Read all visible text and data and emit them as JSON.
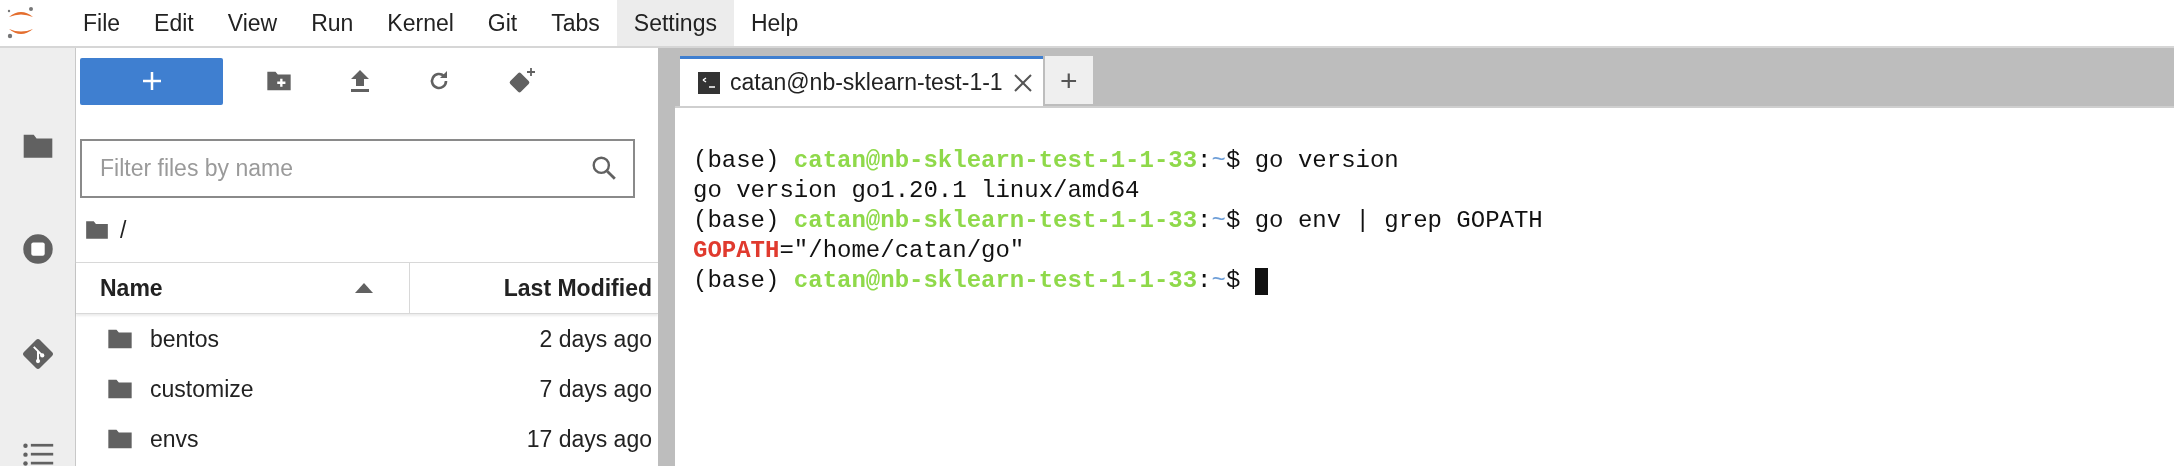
{
  "menu": [
    {
      "label": "File",
      "selected": false
    },
    {
      "label": "Edit",
      "selected": false
    },
    {
      "label": "View",
      "selected": false
    },
    {
      "label": "Run",
      "selected": false
    },
    {
      "label": "Kernel",
      "selected": false
    },
    {
      "label": "Git",
      "selected": false
    },
    {
      "label": "Tabs",
      "selected": false
    },
    {
      "label": "Settings",
      "selected": true
    },
    {
      "label": "Help",
      "selected": false
    }
  ],
  "file_browser": {
    "filter": {
      "placeholder": "Filter files by name"
    },
    "breadcrumb": "/",
    "columns": [
      {
        "label": "Name",
        "sorted": true
      },
      {
        "label": "Last Modified",
        "sorted": false
      }
    ],
    "rows": [
      {
        "name": "bentos",
        "modified": "2 days ago"
      },
      {
        "name": "customize",
        "modified": "7 days ago"
      },
      {
        "name": "envs",
        "modified": "17 days ago"
      }
    ]
  },
  "terminal": {
    "tab": {
      "title": "catan@nb-sklearn-test-1-1",
      "selected": true
    },
    "new_tab": "+",
    "lines": [
      {
        "cursor": false,
        "segments": [
          {
            "kind": "plain",
            "text": "(base) "
          },
          {
            "kind": "user",
            "text": "catan@nb-sklearn-test-1-1-33"
          },
          {
            "kind": "plain",
            "text": ":"
          },
          {
            "kind": "path",
            "text": "~"
          },
          {
            "kind": "plain",
            "text": "$ go version"
          }
        ]
      },
      {
        "cursor": false,
        "segments": [
          {
            "kind": "plain",
            "text": "go version go1.20.1 linux/amd64"
          }
        ]
      },
      {
        "cursor": false,
        "segments": [
          {
            "kind": "plain",
            "text": "(base) "
          },
          {
            "kind": "user",
            "text": "catan@nb-sklearn-test-1-1-33"
          },
          {
            "kind": "plain",
            "text": ":"
          },
          {
            "kind": "path",
            "text": "~"
          },
          {
            "kind": "plain",
            "text": "$ go env | grep GOPATH"
          }
        ]
      },
      {
        "cursor": false,
        "segments": [
          {
            "kind": "var",
            "text": "GOPATH"
          },
          {
            "kind": "plain",
            "text": "=\"/home/catan/go\""
          }
        ]
      },
      {
        "cursor": true,
        "segments": [
          {
            "kind": "plain",
            "text": "(base) "
          },
          {
            "kind": "user",
            "text": "catan@nb-sklearn-test-1-1-33"
          },
          {
            "kind": "plain",
            "text": ":"
          },
          {
            "kind": "path",
            "text": "~"
          },
          {
            "kind": "plain",
            "text": "$ "
          }
        ]
      }
    ]
  }
}
